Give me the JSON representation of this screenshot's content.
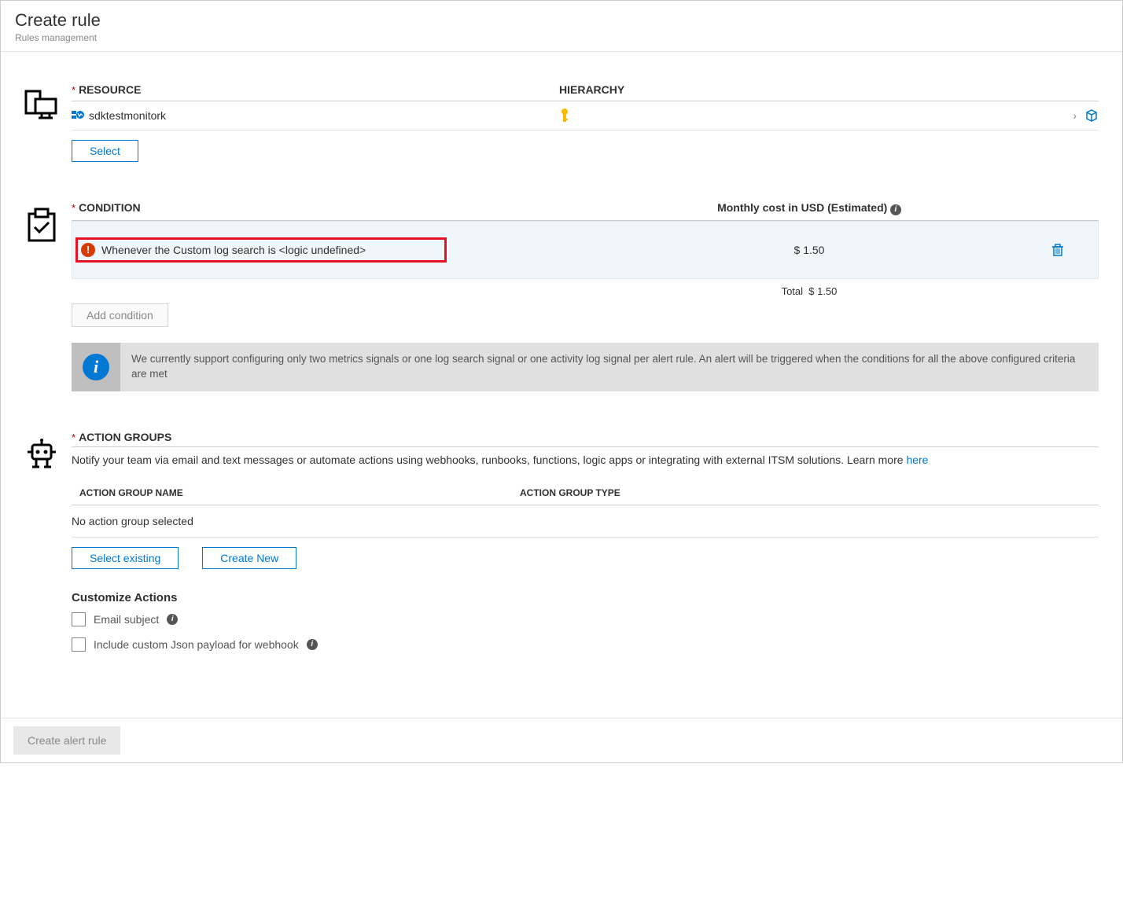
{
  "page": {
    "title": "Create rule",
    "subtitle": "Rules management"
  },
  "resource": {
    "label": "RESOURCE",
    "hierarchy_label": "HIERARCHY",
    "name": "sdktestmonitork",
    "select_btn": "Select"
  },
  "condition": {
    "label": "CONDITION",
    "cost_label": "Monthly cost in USD (Estimated)",
    "text": "Whenever the Custom log search is <logic undefined>",
    "cost": "$ 1.50",
    "total_label": "Total",
    "total_value": "$ 1.50",
    "add_btn": "Add condition",
    "info": "We currently support configuring only two metrics signals or one log search signal or one activity log signal per alert rule. An alert will be triggered when the conditions for all the above configured criteria are met"
  },
  "action_groups": {
    "label": "ACTION GROUPS",
    "desc": "Notify your team via email and text messages or automate actions using webhooks, runbooks, functions, logic apps or integrating with external ITSM solutions. Learn more ",
    "learn_more": "here",
    "col_name": "ACTION GROUP NAME",
    "col_type": "ACTION GROUP TYPE",
    "empty": "No action group selected",
    "select_existing": "Select existing",
    "create_new": "Create New",
    "customize_title": "Customize Actions",
    "email_subject": "Email subject",
    "include_json": "Include custom Json payload for webhook"
  },
  "footer": {
    "create_btn": "Create alert rule"
  }
}
